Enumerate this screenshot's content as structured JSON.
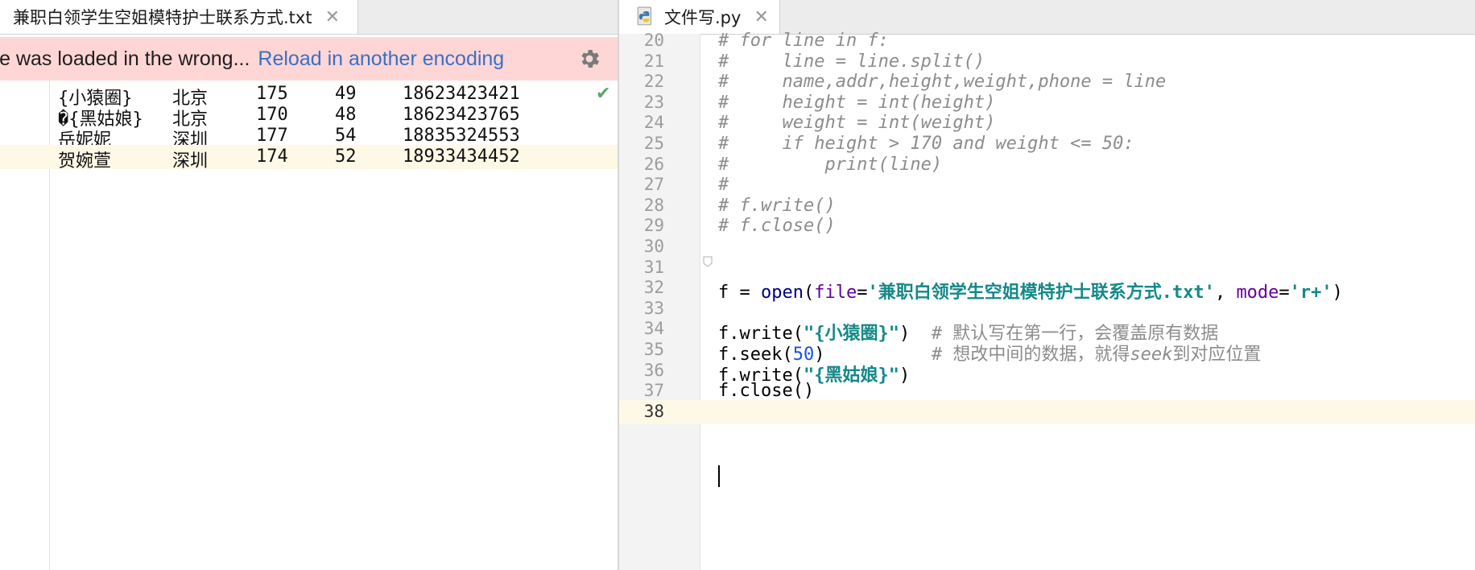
{
  "left_tab": {
    "title": "兼职白领学生空姐模特护士联系方式.txt",
    "close": "✕"
  },
  "banner": {
    "message": "ile was loaded in the wrong...",
    "action": "Reload in another encoding"
  },
  "txt_rows": [
    [
      "{小猿圈}",
      "北京",
      "175",
      "49",
      "18623423421"
    ],
    [
      "�{黑姑娘}",
      "北京",
      "170",
      "48",
      "18623423765"
    ],
    [
      "岳妮妮",
      "深圳",
      "177",
      "54",
      "18835324553"
    ],
    [
      "贺婉萱",
      "深圳",
      "174",
      "52",
      "18933434452"
    ]
  ],
  "right_tab": {
    "title": "文件写.py",
    "close": "✕"
  },
  "code_lines": [
    {
      "n": "20",
      "parts": [
        [
          "cm",
          "# for line in f:"
        ]
      ]
    },
    {
      "n": "21",
      "parts": [
        [
          "cm",
          "#     line = line.split()"
        ]
      ]
    },
    {
      "n": "22",
      "parts": [
        [
          "cm",
          "#     name,addr,height,weight,phone = line"
        ]
      ]
    },
    {
      "n": "23",
      "parts": [
        [
          "cm",
          "#     height = int(height)"
        ]
      ]
    },
    {
      "n": "24",
      "parts": [
        [
          "cm",
          "#     weight = int(weight)"
        ]
      ]
    },
    {
      "n": "25",
      "parts": [
        [
          "cm",
          "#     if height > 170 and weight <= 50:"
        ]
      ]
    },
    {
      "n": "26",
      "parts": [
        [
          "cm",
          "#         print(line)"
        ]
      ]
    },
    {
      "n": "27",
      "parts": [
        [
          "cm",
          "#"
        ]
      ]
    },
    {
      "n": "28",
      "parts": [
        [
          "cm",
          "# f.write()"
        ]
      ]
    },
    {
      "n": "29",
      "parts": [
        [
          "cm",
          "# f.close()"
        ]
      ]
    },
    {
      "n": "30",
      "parts": []
    },
    {
      "n": "31",
      "parts": []
    },
    {
      "n": "32",
      "parts": [
        [
          "txt",
          "f = "
        ],
        [
          "kw",
          "open"
        ],
        [
          "txt",
          "("
        ],
        [
          "param",
          "file"
        ],
        [
          "txt",
          "="
        ],
        [
          "str-teal",
          "'兼职白领学生空姐模特护士联系方式.txt'"
        ],
        [
          "txt",
          ", "
        ],
        [
          "param",
          "mode"
        ],
        [
          "txt",
          "="
        ],
        [
          "str-teal",
          "'r+'"
        ],
        [
          "txt",
          ")"
        ]
      ]
    },
    {
      "n": "33",
      "parts": []
    },
    {
      "n": "34",
      "parts": [
        [
          "txt",
          "f.write("
        ],
        [
          "str-teal",
          "\"{小猿圈}\""
        ],
        [
          "txt",
          ")  "
        ],
        [
          "cm-plain",
          "# 默认写在第一行，会覆盖原有数据"
        ]
      ]
    },
    {
      "n": "35",
      "parts": [
        [
          "txt",
          "f.seek("
        ],
        [
          "num",
          "50"
        ],
        [
          "txt",
          ")          "
        ],
        [
          "cm-plain",
          "# 想改中间的数据，就得"
        ],
        [
          "cm",
          "seek"
        ],
        [
          "cm-plain",
          "到对应位置"
        ]
      ]
    },
    {
      "n": "36",
      "parts": [
        [
          "txt",
          "f.write("
        ],
        [
          "str-teal",
          "\"{黑姑娘}\""
        ],
        [
          "txt",
          ")"
        ]
      ]
    },
    {
      "n": "37",
      "parts": [
        [
          "txt",
          "f.close()"
        ]
      ]
    },
    {
      "n": "38",
      "parts": [],
      "current": true
    }
  ],
  "colors": {
    "banner_bg": "#ffd6d6",
    "link": "#3a6fc4",
    "current_line": "#fdf9e6",
    "check": "#59a869"
  }
}
